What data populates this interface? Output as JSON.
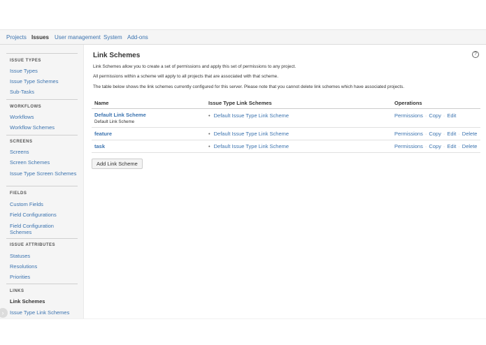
{
  "nav": {
    "tabs": [
      {
        "label": "Projects"
      },
      {
        "label": "Issues"
      },
      {
        "label": "User management"
      },
      {
        "label": "System"
      },
      {
        "label": "Add-ons"
      }
    ]
  },
  "sidebar": {
    "sections": [
      {
        "title": "ISSUE TYPES",
        "items": [
          "Issue Types",
          "Issue Type Schemes",
          "Sub-Tasks"
        ]
      },
      {
        "title": "WORKFLOWS",
        "items": [
          "Workflows",
          "Workflow Schemes"
        ]
      },
      {
        "title": "SCREENS",
        "items": [
          "Screens",
          "Screen Schemes",
          "Issue Type Screen Schemes"
        ]
      },
      {
        "title": "FIELDS",
        "items": [
          "Custom Fields",
          "Field Configurations",
          "Field Configuration Schemes"
        ]
      },
      {
        "title": "ISSUE ATTRIBUTES",
        "items": [
          "Statuses",
          "Resolutions",
          "Priorities"
        ]
      },
      {
        "title": "LINKS",
        "items": [
          "Link Schemes",
          "Issue Type Link Schemes"
        ]
      }
    ]
  },
  "main": {
    "title": "Link Schemes",
    "help_glyph": "?",
    "desc1": "Link Schemes allow you to create a set of permissions and apply this set of permissions to any project.",
    "desc2": "All permissions within a scheme will apply to all projects that are associated with that scheme.",
    "desc3": "The table below shows the link schemes currently configured for this server. Please note that you cannot delete link schemes which have associated projects.",
    "columns": {
      "name": "Name",
      "issue_type": "Issue Type Link Schemes",
      "operations": "Operations"
    },
    "rows": [
      {
        "name": "Default Link Scheme",
        "description": "Default Link Scheme",
        "issue_type": "Default Issue Type Link Scheme",
        "ops": [
          "Permissions",
          "Copy",
          "Edit"
        ]
      },
      {
        "name": "feature",
        "description": "",
        "issue_type": "Default Issue Type Link Scheme",
        "ops": [
          "Permissions",
          "Copy",
          "Edit",
          "Delete"
        ]
      },
      {
        "name": "task",
        "description": "",
        "issue_type": "Default Issue Type Link Scheme",
        "ops": [
          "Permissions",
          "Copy",
          "Edit",
          "Delete"
        ]
      }
    ],
    "add_button": "Add Link Scheme"
  },
  "colors": {
    "link": "#3b73af",
    "text": "#333333",
    "sidebar_bg": "#f5f5f5"
  },
  "icons": {
    "help": "help-icon",
    "scroll": "chevron-right-icon"
  }
}
